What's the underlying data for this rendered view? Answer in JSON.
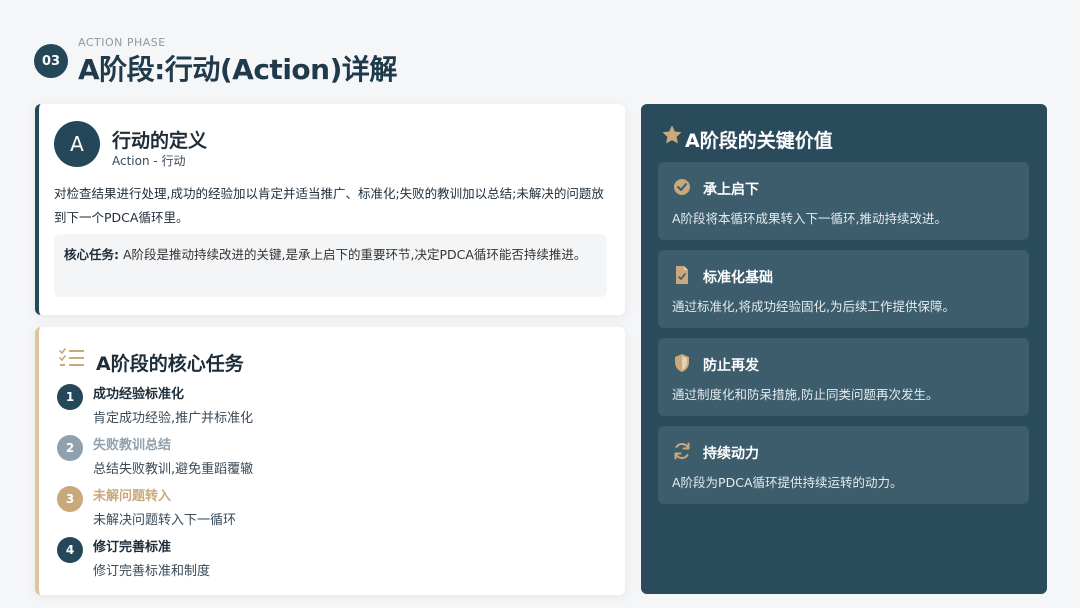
{
  "header": {
    "number": "03",
    "phase_label": "ACTION PHASE",
    "title": "A阶段:行动(Action)详解"
  },
  "definition": {
    "avatar_letter": "A",
    "title": "行动的定义",
    "subtitle": "Action - 行动",
    "description": "对检查结果进行处理,成功的经验加以肯定并适当推广、标准化;失败的教训加以总结;未解决的问题放到下一个PDCA循环里。",
    "core_label": "核心任务:",
    "core_text": " A阶段是推动持续改进的关键,是承上启下的重要环节,决定PDCA循环能否持续推进。"
  },
  "tasks": {
    "icon": "checklist-icon",
    "title": "A阶段的核心任务",
    "items": [
      {
        "num": "1",
        "title": "成功经验标准化",
        "desc": "肯定成功经验,推广并标准化",
        "color": "#24475a",
        "title_color": "#1f2d3a"
      },
      {
        "num": "2",
        "title": "失败教训总结",
        "desc": "总结失败教训,避免重蹈覆辙",
        "color": "#8fa1ae",
        "title_color": "#8fa1ae"
      },
      {
        "num": "3",
        "title": "未解问题转入",
        "desc": "未解决问题转入下一循环",
        "color": "#c9a87c",
        "title_color": "#c9a87c"
      },
      {
        "num": "4",
        "title": "修订完善标准",
        "desc": "修订完善标准和制度",
        "color": "#24475a",
        "title_color": "#1f2d3a"
      }
    ]
  },
  "values_panel": {
    "icon": "star-icon",
    "title": "A阶段的关键价值",
    "items": [
      {
        "icon": "check-circle-icon",
        "title": "承上启下",
        "desc": "A阶段将本循环成果转入下一循环,推动持续改进。"
      },
      {
        "icon": "document-icon",
        "title": "标准化基础",
        "desc": "通过标准化,将成功经验固化,为后续工作提供保障。"
      },
      {
        "icon": "shield-icon",
        "title": "防止再发",
        "desc": "通过制度化和防呆措施,防止同类问题再次发生。"
      },
      {
        "icon": "refresh-icon",
        "title": "持续动力",
        "desc": "A阶段为PDCA循环提供持续运转的动力。"
      }
    ]
  },
  "colors": {
    "primary": "#24475a",
    "accent": "#c9a87c",
    "panel": "#2a4b5c",
    "panel_card": "#3d5d6d"
  }
}
